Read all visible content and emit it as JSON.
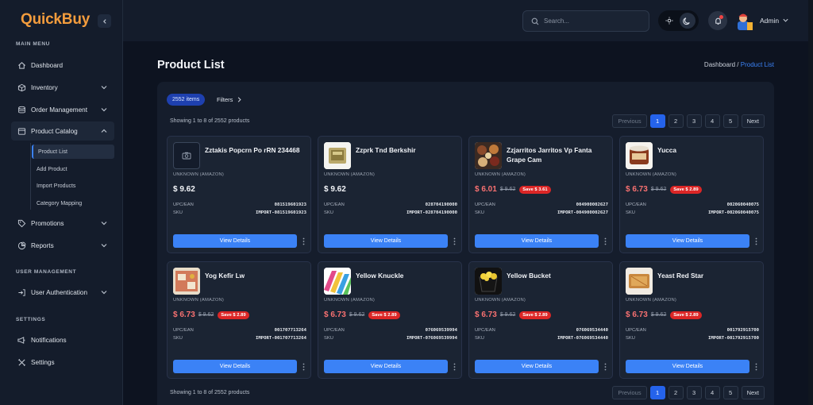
{
  "app": {
    "brand": "QuickBuy",
    "collapse_icon": "chevron-left-icon"
  },
  "sidebar": {
    "sections": {
      "main": "MAIN MENU",
      "users": "USER MANAGEMENT",
      "settings": "SETTINGS"
    },
    "items": [
      {
        "label": "Dashboard",
        "icon": "home-icon"
      },
      {
        "label": "Inventory",
        "icon": "box-icon"
      },
      {
        "label": "Order Management",
        "icon": "database-icon"
      },
      {
        "label": "Product Catalog",
        "icon": "catalog-icon"
      },
      {
        "label": "Promotions",
        "icon": "tag-icon"
      },
      {
        "label": "Reports",
        "icon": "chart-icon"
      },
      {
        "label": "User Authentication",
        "icon": "login-icon"
      },
      {
        "label": "Notifications",
        "icon": "megaphone-icon"
      },
      {
        "label": "Settings",
        "icon": "tools-icon"
      }
    ],
    "sub_items": [
      "Product List",
      "Add Product",
      "Import Products",
      "Category Mapping"
    ]
  },
  "header": {
    "search_placeholder": "Search...",
    "user_name": "Admin"
  },
  "page": {
    "title": "Product List",
    "breadcrumb": {
      "root": "Dashboard /",
      "current": "Product List"
    },
    "count_badge": "2552 items",
    "filters_label": "Filters",
    "showing_top": "Showing 1 to 8 of 2552 products",
    "showing_bottom": "Showing 1 to 8 of 2552 products",
    "pagination": {
      "previous": "Previous",
      "pages": [
        "1",
        "2",
        "3",
        "4",
        "5"
      ],
      "current": "1",
      "next": "Next"
    },
    "labels": {
      "upc": "UPC/EAN",
      "sku": "SKU",
      "view": "View Details"
    }
  },
  "products": [
    {
      "name": "Zztakis Popcrn Po rRN 234468",
      "brand": "UNKNOWN (AMAZON)",
      "price": "$ 9.62",
      "original": "",
      "save": "",
      "upc": "081519601923",
      "sku": "IMPORT-081519601923"
    },
    {
      "name": "Zzprk Tnd Berkshir",
      "brand": "UNKNOWN (AMAZON)",
      "price": "$ 9.62",
      "original": "",
      "save": "",
      "upc": "028704190000",
      "sku": "IMPORT-028704190000"
    },
    {
      "name": "Zzjarritos Jarritos Vp Fanta Grape Cam",
      "brand": "UNKNOWN (AMAZON)",
      "price": "$ 6.01",
      "original": "$ 9.62",
      "save": "Save $ 3.61",
      "upc": "004900002627",
      "sku": "IMPORT-004900002627"
    },
    {
      "name": "Yucca",
      "brand": "UNKNOWN (AMAZON)",
      "price": "$ 6.73",
      "original": "$ 9.62",
      "save": "Save $ 2.89",
      "upc": "002060040075",
      "sku": "IMPORT-002060040075"
    },
    {
      "name": "Yog Kefir Lw",
      "brand": "UNKNOWN (AMAZON)",
      "price": "$ 6.73",
      "original": "$ 9.62",
      "save": "Save $ 2.89",
      "upc": "001707713264",
      "sku": "IMPORT-001707713264"
    },
    {
      "name": "Yellow Knuckle",
      "brand": "UNKNOWN (AMAZON)",
      "price": "$ 6.73",
      "original": "$ 9.62",
      "save": "Save $ 2.89",
      "upc": "076069539994",
      "sku": "IMPORT-076069539994"
    },
    {
      "name": "Yellow Bucket",
      "brand": "UNKNOWN (AMAZON)",
      "price": "$ 6.73",
      "original": "$ 9.62",
      "save": "Save $ 2.89",
      "upc": "076069534440",
      "sku": "IMPORT-076069534440"
    },
    {
      "name": "Yeast Red Star",
      "brand": "UNKNOWN (AMAZON)",
      "price": "$ 6.73",
      "original": "$ 9.62",
      "save": "Save $ 2.89",
      "upc": "001792915700",
      "sku": "IMPORT-001792915700"
    }
  ],
  "colors": {
    "accent": "#3b82f6",
    "brand": "#f39c3d",
    "sale": "#f87171",
    "badge": "#dc2626"
  }
}
